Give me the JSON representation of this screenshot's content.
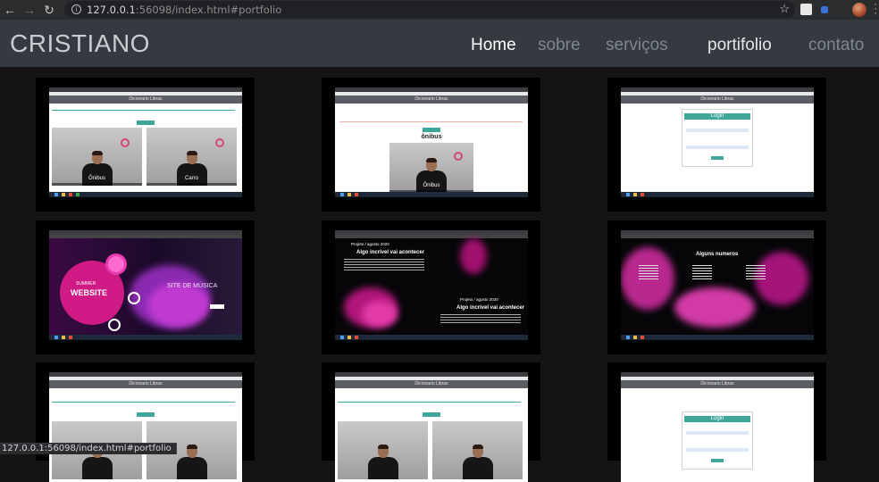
{
  "browser": {
    "url_host": "127.0.0.1",
    "url_rest": ":56098/index.html#portfolio",
    "status_url": "127.0.0.1:56098/index.html#portfolio"
  },
  "navbar": {
    "brand": "CRISTIANO",
    "items": [
      "Home",
      "sobre",
      "serviços",
      "portifolio",
      "contato"
    ]
  },
  "portfolio": {
    "app_title": "Dicionario Libras",
    "video_labels": [
      "Ônibus",
      "Carro"
    ],
    "single_video_title": "ônibus",
    "login_title": "Login",
    "music_hero": "SUMMER",
    "music_word": "WEBSITE",
    "music_site": "SITE DE MÚSICA",
    "project_title": "Projeto / agosto 2020",
    "project_sub": "Algo incrível vai acontecer",
    "numbers_title": "Alguns numeros"
  },
  "colors": {
    "accent": "#3ea79a",
    "navbar": "#343a40",
    "magenta": "#d0299a"
  }
}
